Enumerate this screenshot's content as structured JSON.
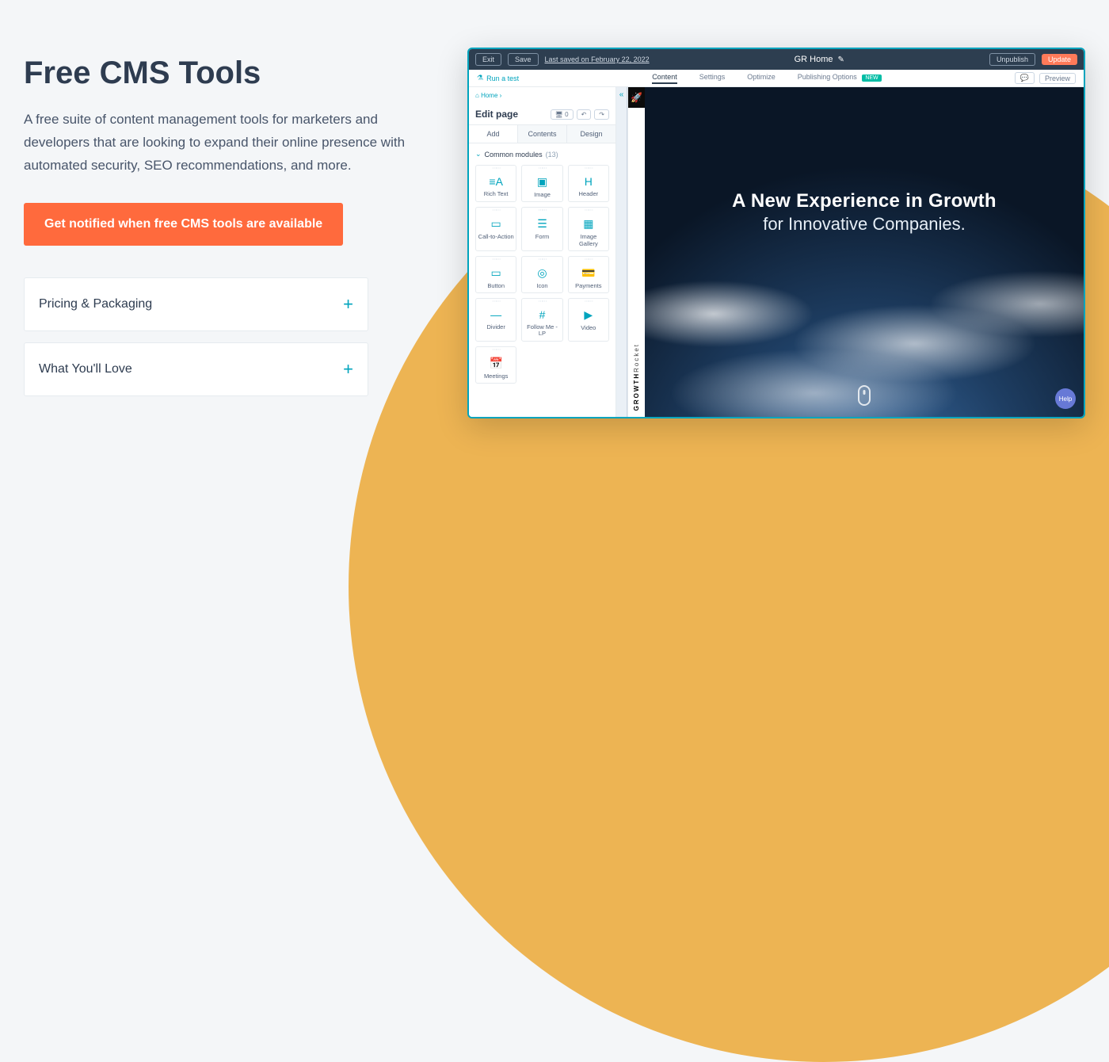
{
  "left_column": {
    "heading": "Free CMS Tools",
    "subheading": "A free suite of content management tools for marketers and developers that are looking to expand their online presence with automated security, SEO recommendations, and more.",
    "cta": "Get notified when free CMS tools are available",
    "accordions": [
      {
        "label": "Pricing & Packaging"
      },
      {
        "label": "What You'll Love"
      }
    ]
  },
  "app": {
    "topbar": {
      "exit": "Exit",
      "save": "Save",
      "last_saved": "Last saved on February 22, 2022",
      "title": "GR Home",
      "unpublish": "Unpublish",
      "update": "Update"
    },
    "tabbar": {
      "run_test": "Run a test",
      "tabs": [
        "Content",
        "Settings",
        "Optimize",
        "Publishing Options"
      ],
      "active_tab_index": 0,
      "new_badge": "NEW",
      "preview": "Preview"
    },
    "panel": {
      "breadcrumb": "Home",
      "title": "Edit page",
      "counter": "0",
      "subtabs": [
        "Add",
        "Contents",
        "Design"
      ],
      "active_subtab_index": 0,
      "section": {
        "label": "Common modules",
        "count": "(13)"
      },
      "modules": [
        {
          "label": "Rich Text",
          "icon": "≡A"
        },
        {
          "label": "Image",
          "icon": "▣"
        },
        {
          "label": "Header",
          "icon": "H"
        },
        {
          "label": "Call-to-Action",
          "icon": "▭"
        },
        {
          "label": "Form",
          "icon": "☰"
        },
        {
          "label": "Image Gallery",
          "icon": "▦"
        },
        {
          "label": "Button",
          "icon": "▭"
        },
        {
          "label": "Icon",
          "icon": "◎"
        },
        {
          "label": "Payments",
          "icon": "💳"
        },
        {
          "label": "Divider",
          "icon": "—"
        },
        {
          "label": "Follow Me - LP",
          "icon": "#"
        },
        {
          "label": "Video",
          "icon": "▶"
        },
        {
          "label": "Meetings",
          "icon": "📅"
        }
      ]
    },
    "brand_rail": {
      "bold": "GROWTH",
      "light": "Rocket",
      "icon": "🚀"
    },
    "hero": {
      "line1": "A New Experience in Growth",
      "line2": "for Innovative Companies."
    },
    "help": "Help"
  }
}
